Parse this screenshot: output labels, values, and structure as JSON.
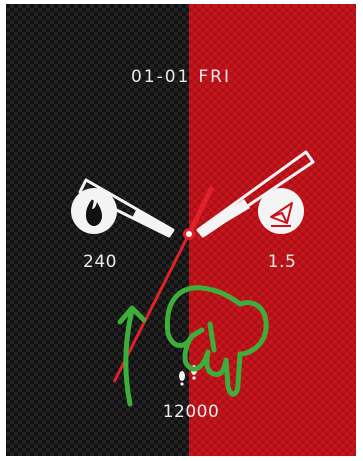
{
  "watchface": {
    "date": "01-01",
    "weekday": "FRI",
    "complications": {
      "calories": {
        "icon": "flame-icon",
        "value": "240"
      },
      "distance": {
        "icon": "paper-plane-icon",
        "value": "1.5"
      },
      "steps": {
        "icon": "footsteps-icon",
        "value": "12000"
      }
    },
    "colors": {
      "left_background": "#111111",
      "right_background": "#c8141c",
      "accent": "#e0202a",
      "gesture": "#3dae3a"
    },
    "gesture_hint": {
      "type": "swipe-up",
      "icon": "hand-pointer-icon"
    }
  }
}
